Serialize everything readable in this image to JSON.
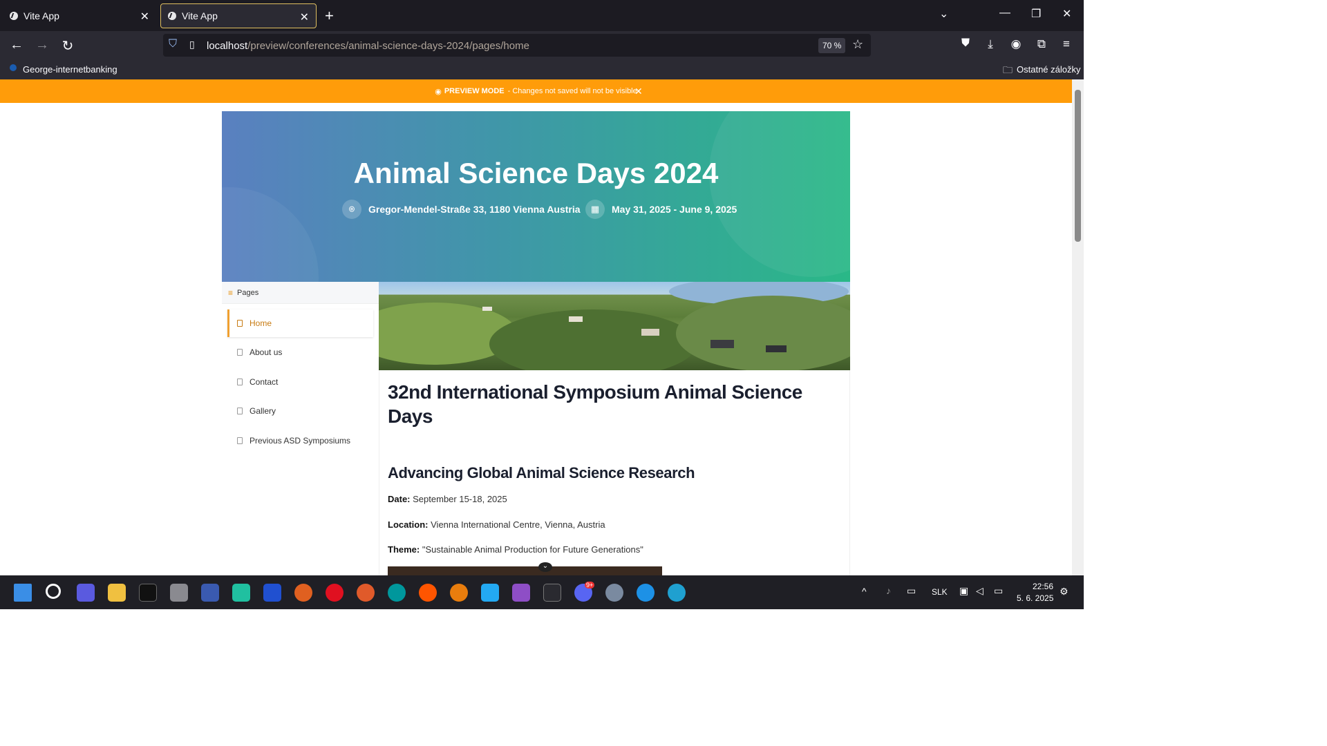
{
  "browser": {
    "tabs": [
      {
        "title": "Vite App"
      },
      {
        "title": "Vite App"
      }
    ],
    "url_host": "localhost",
    "url_path": "/preview/conferences/animal-science-days-2024/pages/home",
    "zoom": "70 %",
    "bookmarks": {
      "left": "George-internetbanking",
      "right": "Ostatné záložky"
    }
  },
  "banner": {
    "mode": "PREVIEW MODE",
    "message": "- Changes not saved will not be visible"
  },
  "hero": {
    "title": "Animal Science Days 2024",
    "location": "Gregor-Mendel-Straße 33, 1180 Vienna Austria",
    "dates": "May 31, 2025 - June 9, 2025"
  },
  "sidebar": {
    "heading": "Pages",
    "items": [
      {
        "label": "Home"
      },
      {
        "label": "About us"
      },
      {
        "label": "Contact"
      },
      {
        "label": "Gallery"
      },
      {
        "label": "Previous ASD Symposiums"
      }
    ]
  },
  "article": {
    "title": "32nd International Symposium Animal Science Days",
    "subtitle": "Advancing Global Animal Science Research",
    "date_label": "Date:",
    "date_value": "September 15-18, 2025",
    "location_label": "Location:",
    "location_value": "Vienna International Centre, Vienna, Austria",
    "theme_label": "Theme:",
    "theme_value": "\"Sustainable Animal Production for Future Generations\""
  },
  "taskbar": {
    "lang": "SLK",
    "time": "22:56",
    "date": "5. 6. 2025",
    "discord_badge": "9+"
  },
  "colors": {
    "banner": "#ff9c0a",
    "accent": "#f0a030",
    "hero_start": "#5a80c0",
    "hero_end": "#2ab887"
  }
}
